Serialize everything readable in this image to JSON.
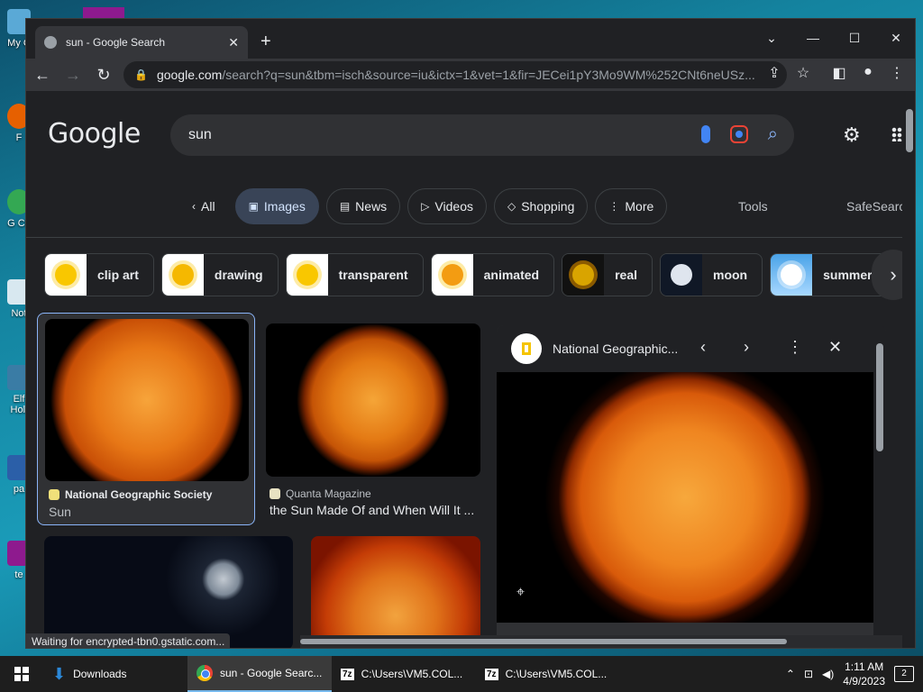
{
  "desktop": {
    "icons": [
      "My C",
      "F",
      "G Ch",
      "Not",
      "Elf Holi",
      "pa",
      "te"
    ]
  },
  "browser": {
    "tab_title": "sun - Google Search",
    "new_tab_symbol": "+",
    "url_host": "google.com",
    "url_path": "/search?q=sun&tbm=isch&source=iu&ictx=1&vet=1&fir=JECei1pY3Mo9WM%252CNt6neUSz..."
  },
  "google": {
    "logo": "Google",
    "query": "sun",
    "tabs": [
      {
        "label": "All",
        "icon": "‹"
      },
      {
        "label": "Images",
        "icon": "▣"
      },
      {
        "label": "News",
        "icon": "▤"
      },
      {
        "label": "Videos",
        "icon": "▷"
      },
      {
        "label": "Shopping",
        "icon": "◇"
      },
      {
        "label": "More",
        "icon": "⋮"
      }
    ],
    "tools": "Tools",
    "safesearch": "SafeSearch",
    "chips": [
      "clip art",
      "drawing",
      "transparent",
      "animated",
      "real",
      "moon",
      "summer"
    ],
    "results": [
      {
        "source": "National Geographic Society",
        "title": "Sun"
      },
      {
        "source": "Quanta Magazine",
        "title": "the Sun Made Of and When Will It ..."
      },
      {
        "source": "",
        "title": ""
      },
      {
        "source": "",
        "title": ""
      }
    ],
    "preview": {
      "source": "National Geographic..."
    }
  },
  "status_text": "Waiting for encrypted-tbn0.gstatic.com...",
  "taskbar": {
    "items": [
      {
        "label": "Downloads"
      },
      {
        "label": "sun - Google Searc..."
      },
      {
        "label": "C:\\Users\\VM5.COL..."
      },
      {
        "label": "C:\\Users\\VM5.COL..."
      }
    ],
    "time": "1:11 AM",
    "date": "4/9/2023",
    "notifications": "2"
  },
  "colors": {
    "page_bg": "#202124",
    "accent_blue": "#8ab4f8",
    "active_tab_bg": "#394457"
  }
}
